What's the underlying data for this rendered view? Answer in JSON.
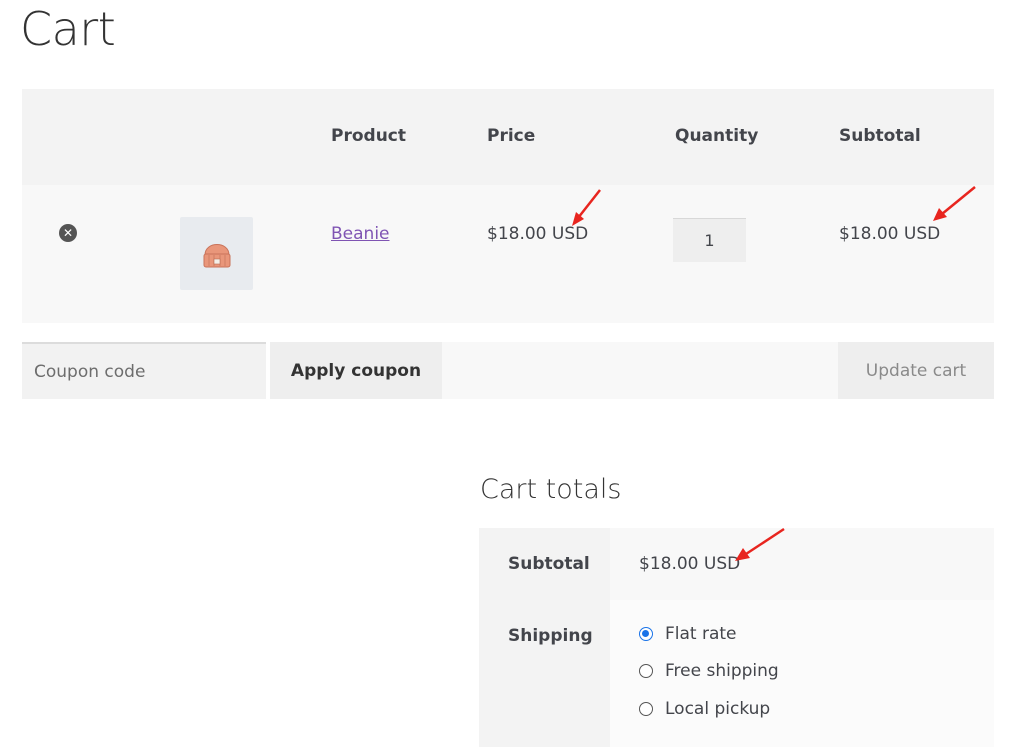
{
  "page": {
    "title": "Cart"
  },
  "cart_table": {
    "headers": {
      "product": "Product",
      "price": "Price",
      "quantity": "Quantity",
      "subtotal": "Subtotal"
    },
    "rows": [
      {
        "remove_icon": "remove-circle-icon",
        "thumbnail": "beanie-icon",
        "product": "Beanie",
        "price": "$18.00 USD",
        "quantity": "1",
        "subtotal": "$18.00 USD"
      }
    ]
  },
  "actions": {
    "coupon_placeholder": "Coupon code",
    "apply_coupon_label": "Apply coupon",
    "update_cart_label": "Update cart"
  },
  "cart_totals": {
    "title": "Cart totals",
    "subtotal_label": "Subtotal",
    "subtotal_value": "$18.00 USD",
    "shipping_label": "Shipping",
    "shipping_options": [
      {
        "label": "Flat rate",
        "selected": true
      },
      {
        "label": "Free shipping",
        "selected": false
      },
      {
        "label": "Local pickup",
        "selected": false
      }
    ]
  },
  "colors": {
    "link": "#7f54b3",
    "radio_selected": "#1a73e8",
    "annotation_arrow": "#e8251f"
  }
}
